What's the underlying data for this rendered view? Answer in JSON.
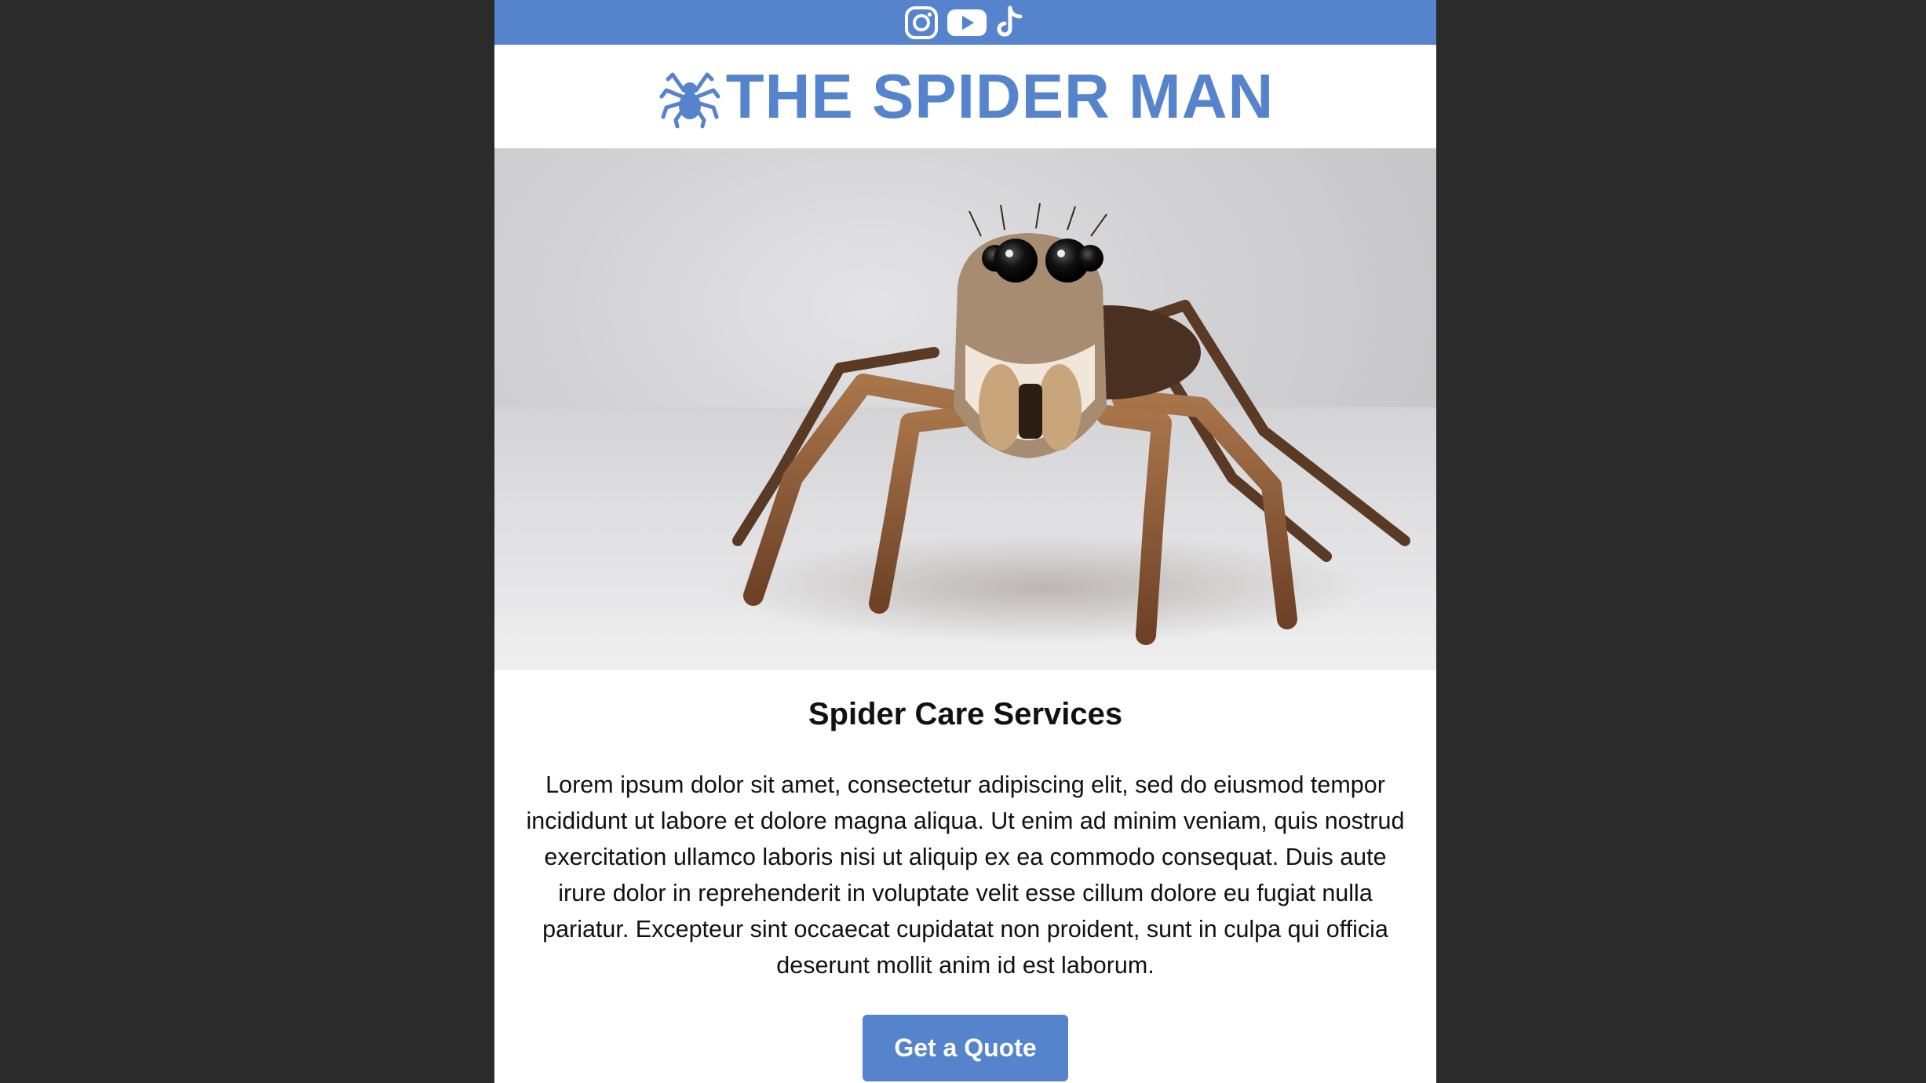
{
  "colors": {
    "brand": "#5583cc",
    "outer_background": "#2b2b2b",
    "text": "#111111"
  },
  "social": [
    "instagram-icon",
    "youtube-icon",
    "tiktok-icon"
  ],
  "header": {
    "logo_icon": "spider-icon",
    "title": "THE SPIDER MAN"
  },
  "hero": {
    "image": "jumping-spider-photo"
  },
  "main": {
    "heading": "Spider Care Services",
    "body": "Lorem ipsum dolor sit amet, consectetur adipiscing elit, sed do eiusmod tempor incididunt ut labore et dolore magna aliqua. Ut enim ad minim veniam, quis nostrud exercitation ullamco laboris nisi ut aliquip ex ea commodo consequat. Duis aute irure dolor in reprehenderit in voluptate velit esse cillum dolore eu fugiat nulla pariatur. Excepteur sint occaecat cupidatat non proident, sunt in culpa qui officia deserunt mollit anim id est laborum.",
    "cta_label": "Get a Quote"
  }
}
